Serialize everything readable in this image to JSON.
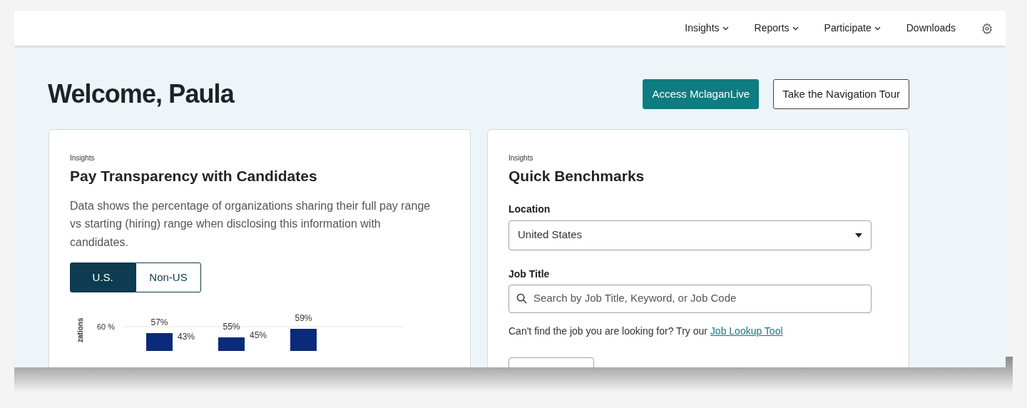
{
  "nav": {
    "items": [
      {
        "label": "Insights",
        "dropdown": true
      },
      {
        "label": "Reports",
        "dropdown": true
      },
      {
        "label": "Participate",
        "dropdown": true
      },
      {
        "label": "Downloads",
        "dropdown": false
      }
    ]
  },
  "welcome": {
    "title": "Welcome, Paula",
    "buttons": [
      {
        "label": "Access MclaganLive",
        "kind": "primary"
      },
      {
        "label": "Take the Navigation Tour",
        "kind": "outline"
      }
    ]
  },
  "pay_card": {
    "eyebrow": "Insights",
    "title": "Pay Transparency with Candidates",
    "description": "Data shows the percentage of organizations sharing their full pay range vs starting (hiring) range when disclosing this information with candidates.",
    "toggle": [
      {
        "label": "U.S.",
        "selected": true
      },
      {
        "label": "Non-US",
        "selected": false
      }
    ],
    "chart": {
      "ylabel": "zations",
      "ytick": "60 %",
      "groups": [
        {
          "bar_label": "57%",
          "side_label": "43%"
        },
        {
          "bar_label": "55%",
          "side_label": "45%"
        },
        {
          "bar_label": "59%"
        }
      ]
    }
  },
  "benchmarks_card": {
    "eyebrow": "Insights",
    "title": "Quick Benchmarks",
    "location": {
      "label": "Location",
      "value": "United States"
    },
    "job_title": {
      "label": "Job Title",
      "placeholder": "Search by Job Title, Keyword, or Job Code"
    },
    "help_text": "Can't find the job you are looking for? Try our",
    "help_link": "Job Lookup Tool"
  }
}
